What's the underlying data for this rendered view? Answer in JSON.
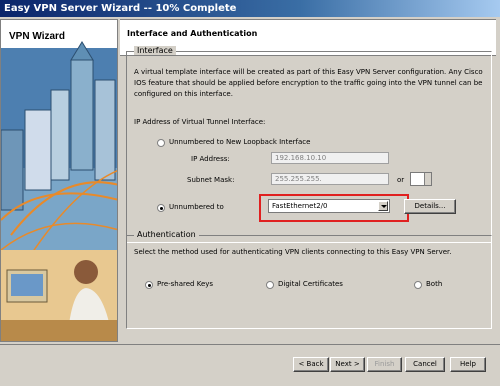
{
  "window": {
    "title": "Easy VPN Server Wizard -- 10% Complete"
  },
  "sidebar": {
    "title": "VPN Wizard"
  },
  "header": {
    "title": "Interface and Authentication"
  },
  "interface_group": {
    "legend": "Interface",
    "description": "A virtual template interface will be created as part of this Easy VPN Server configuration. Any Cisco IOS feature that should be applied before encryption to the traffic going into the VPN tunnel can be configured on this interface.",
    "ip_section_label": "IP Address of Virtual Tunnel Interface:",
    "option_loopback": "Unnumbered to New Loopback Interface",
    "ip_address_label": "IP Address:",
    "ip_address_value": "192.168.10.10",
    "subnet_mask_label": "Subnet Mask:",
    "subnet_mask_value": "255.255.255.",
    "or_label": "or",
    "option_unnumbered": "Unnumbered to",
    "interface_select_value": "FastEthernet2/0",
    "details_button": "Details..."
  },
  "authentication_group": {
    "legend": "Authentication",
    "description": "Select the method used for authenticating VPN clients connecting to this Easy VPN Server.",
    "option_psk": "Pre-shared Keys",
    "option_certs": "Digital Certificates",
    "option_both": "Both"
  },
  "buttons": {
    "back": "< Back",
    "next": "Next >",
    "finish": "Finish",
    "cancel": "Cancel",
    "help": "Help"
  },
  "colors": {
    "highlight": "#e02020",
    "titlebar": "#0a246a"
  }
}
